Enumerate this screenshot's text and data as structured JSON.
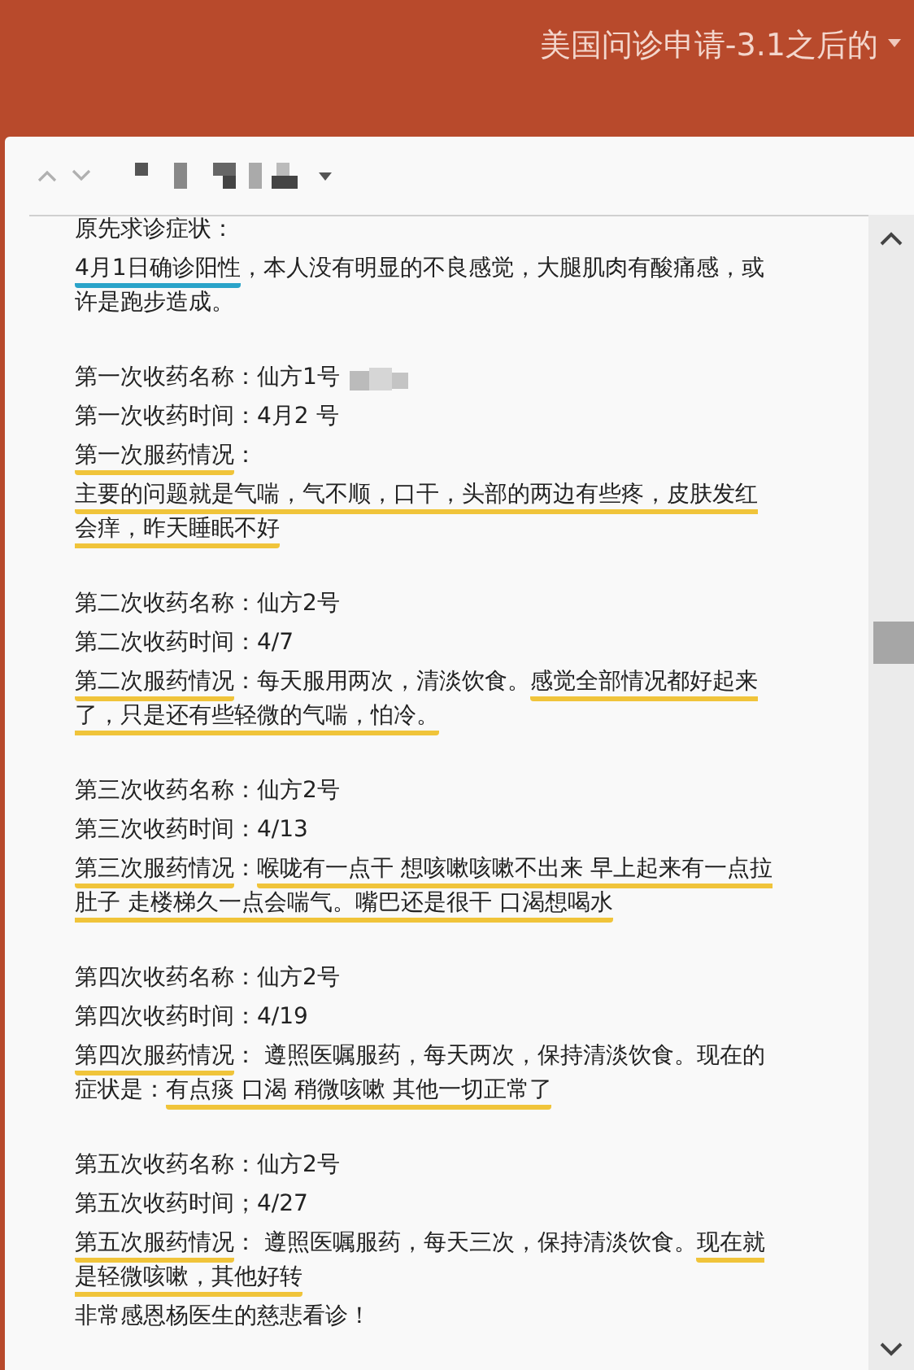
{
  "header": {
    "title": "美国问诊申请-3.1之后的"
  },
  "sections": [
    [
      {
        "segments": [
          {
            "text": "原先求诊症状："
          }
        ]
      },
      {
        "segments": [
          {
            "text": "4月1日确诊阳性",
            "color": "#2aa3c9"
          },
          {
            "text": "，本人没有明显的不良感觉，大腿肌肉有酸痛感，或许是跑步造成。"
          }
        ]
      }
    ],
    [
      {
        "redacted": true,
        "segments": [
          {
            "text": "第一次收药名称：仙方1号"
          }
        ]
      },
      {
        "segments": [
          {
            "text": "第一次收药时间：4月2 号"
          }
        ]
      },
      {
        "segments": [
          {
            "text": "第一次服药情况",
            "color": "#f0c43a"
          },
          {
            "text": "："
          }
        ]
      },
      {
        "segments": [
          {
            "text": "主要的问题就是气喘，气不顺，口干，头部的两边有些疼，皮肤发红会痒，昨天睡眠不好",
            "color": "#f0c43a"
          }
        ]
      }
    ],
    [
      {
        "segments": [
          {
            "text": "第二次收药名称：仙方2号"
          }
        ]
      },
      {
        "segments": [
          {
            "text": "第二次收药时间：4/7"
          }
        ]
      },
      {
        "segments": [
          {
            "text": "第二次服药情况",
            "color": "#f0c43a"
          },
          {
            "text": "：每天服用两次，清淡饮食。"
          },
          {
            "text": "感觉全部情况都好起来了，只是还有些轻微的气喘，怕冷。",
            "color": "#f0c43a"
          }
        ]
      }
    ],
    [
      {
        "segments": [
          {
            "text": "第三次收药名称：仙方2号"
          }
        ]
      },
      {
        "segments": [
          {
            "text": "第三次收药时间：4/13"
          }
        ]
      },
      {
        "segments": [
          {
            "text": "第三次服药情况",
            "color": "#f0c43a"
          },
          {
            "text": "："
          },
          {
            "text": "喉咙有一点干 想咳嗽咳嗽不出来 早上起来有一点拉肚子 走楼梯久一点会喘气。嘴巴还是很干 口渴想喝水",
            "color": "#f0c43a"
          }
        ]
      }
    ],
    [
      {
        "segments": [
          {
            "text": "第四次收药名称：仙方2号"
          }
        ]
      },
      {
        "segments": [
          {
            "text": "第四次收药时间：4/19"
          }
        ]
      },
      {
        "segments": [
          {
            "text": "第四次服药情况",
            "color": "#f0c43a"
          },
          {
            "text": "： 遵照医嘱服药，每天两次，保持清淡饮食。现在的症状是："
          },
          {
            "text": "有点痰 口渴 稍微咳嗽 其他一切正常了",
            "color": "#f0c43a"
          }
        ]
      }
    ],
    [
      {
        "segments": [
          {
            "text": "第五次收药名称：仙方2号"
          }
        ]
      },
      {
        "segments": [
          {
            "text": "第五次收药时间；4/27"
          }
        ]
      },
      {
        "segments": [
          {
            "text": "第五次服药情况",
            "color": "#f0c43a"
          },
          {
            "text": "： 遵照医嘱服药，每天三次，保持清淡饮食。"
          },
          {
            "text": "现在就是轻微咳嗽，其他好转",
            "color": "#f0c43a"
          }
        ]
      },
      {
        "segments": [
          {
            "text": "非常感恩杨医生的慈悲看诊！"
          }
        ]
      }
    ]
  ]
}
